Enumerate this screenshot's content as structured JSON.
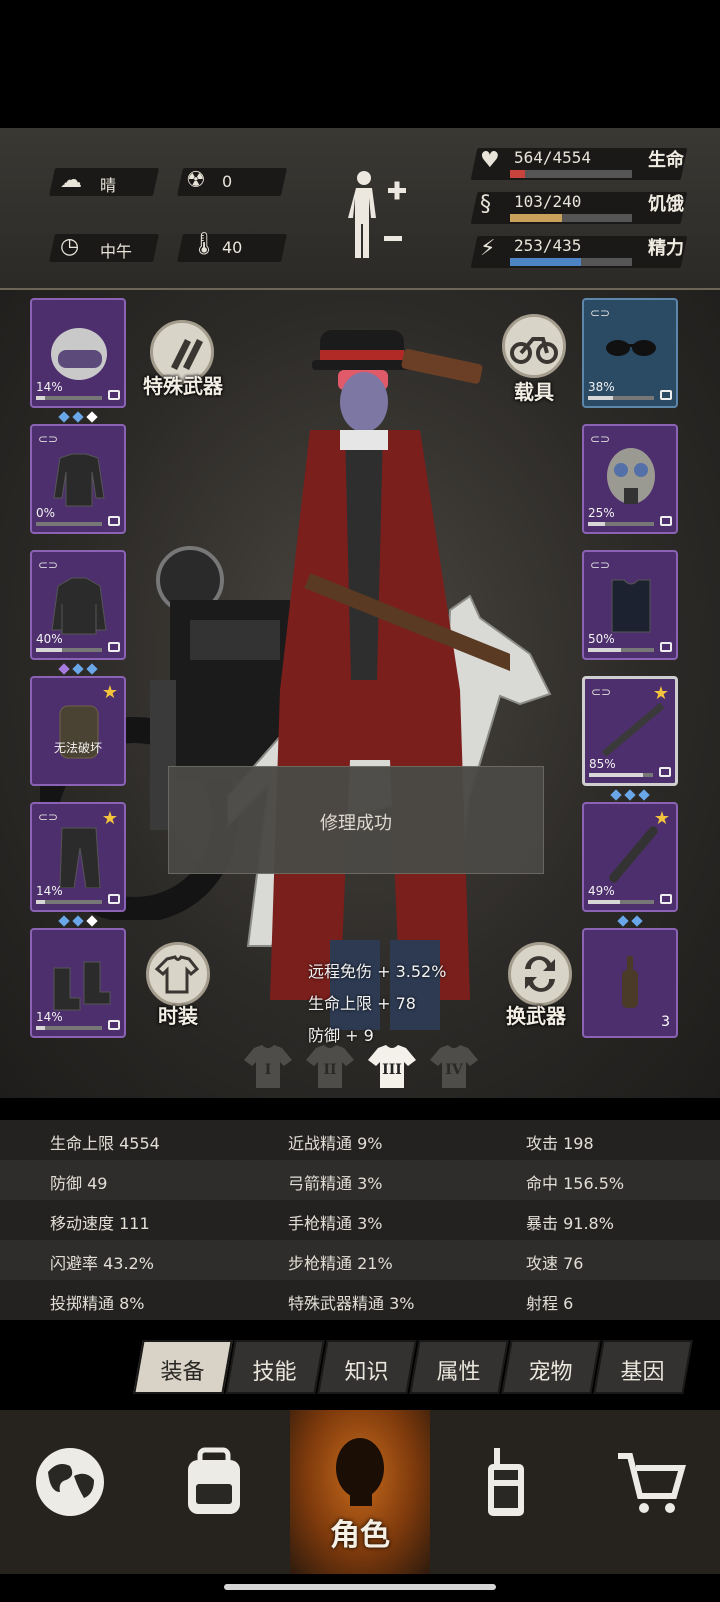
{
  "status": {
    "weather": {
      "icon": "cloud-sun-icon",
      "label": "晴"
    },
    "radiation": {
      "icon": "radiation-icon",
      "value": "0"
    },
    "time": {
      "icon": "clock-icon",
      "label": "中午"
    },
    "temperature": {
      "icon": "thermometer-icon",
      "value": "40"
    },
    "vitals": [
      {
        "icon": "heart-pulse-icon",
        "value": "564/4554",
        "name": "生命",
        "fraction": 0.124,
        "color": "#c8433b"
      },
      {
        "icon": "stomach-icon",
        "value": "103/240",
        "name": "饥饿",
        "fraction": 0.429,
        "color": "#c9a15b"
      },
      {
        "icon": "energy-head-icon",
        "value": "253/435",
        "name": "精力",
        "fraction": 0.582,
        "color": "#4d84c4"
      }
    ]
  },
  "left_slots": [
    {
      "name": "police-helmet",
      "pct": "14%",
      "durability": 0.14,
      "linked": false,
      "star": false,
      "gems": [
        "#6aa7e8",
        "#6aa7e8",
        "#ffffff"
      ]
    },
    {
      "name": "black-shirt",
      "pct": "0%",
      "durability": 0.0,
      "linked": true,
      "star": false,
      "gems": []
    },
    {
      "name": "hooded-jacket",
      "pct": "40%",
      "durability": 0.4,
      "linked": true,
      "star": false,
      "gems": [
        "#a77be0",
        "#6aa7e8",
        "#6aa7e8"
      ]
    },
    {
      "name": "backpack",
      "pct": "",
      "durability": 1.0,
      "linked": false,
      "star": true,
      "unbreakable": "无法破坏",
      "gems": []
    },
    {
      "name": "cargo-pants",
      "pct": "14%",
      "durability": 0.14,
      "linked": true,
      "star": true,
      "gems": [
        "#6aa7e8",
        "#6aa7e8",
        "#ffffff"
      ]
    },
    {
      "name": "boots",
      "pct": "14%",
      "durability": 0.14,
      "linked": false,
      "star": false,
      "gems": []
    }
  ],
  "right_slots": [
    {
      "name": "sunglasses",
      "pct": "38%",
      "durability": 0.38,
      "linked": true,
      "star": false,
      "gems": []
    },
    {
      "name": "gas-mask",
      "pct": "25%",
      "durability": 0.25,
      "linked": true,
      "star": false,
      "gems": []
    },
    {
      "name": "police-vest",
      "pct": "50%",
      "durability": 0.5,
      "linked": true,
      "star": false,
      "gems": []
    },
    {
      "name": "rifle",
      "pct": "85%",
      "durability": 0.85,
      "linked": true,
      "star": true,
      "gems": [
        "#6aa7e8",
        "#6aa7e8",
        "#6aa7e8"
      ]
    },
    {
      "name": "spiked-bat",
      "pct": "49%",
      "durability": 0.49,
      "linked": false,
      "star": true,
      "gems": [
        "#6aa7e8",
        "#6aa7e8"
      ]
    },
    {
      "name": "molotov",
      "pct": "",
      "durability": 1.0,
      "linked": false,
      "star": false,
      "count": "3",
      "gems": []
    }
  ],
  "buttons": {
    "special_weapon": "特殊武器",
    "vehicle": "载具",
    "fashion": "时装",
    "swap_weapon": "换武器"
  },
  "toast": "修理成功",
  "bonuses": [
    "远程免伤 + 3.52%",
    "生命上限 + 78",
    "防御 + 9"
  ],
  "outfit_tabs": [
    "I",
    "II",
    "III",
    "IV"
  ],
  "active_outfit": 2,
  "attributes": [
    [
      "生命上限 4554",
      "近战精通 9%",
      "攻击 198"
    ],
    [
      "防御 49",
      "弓箭精通 3%",
      "命中 156.5%"
    ],
    [
      "移动速度 111",
      "手枪精通 3%",
      "暴击 91.8%"
    ],
    [
      "闪避率 43.2%",
      "步枪精通 21%",
      "攻速 76"
    ],
    [
      "投掷精通 8%",
      "特殊武器精通 3%",
      "射程 6"
    ]
  ],
  "tabs": [
    "装备",
    "技能",
    "知识",
    "属性",
    "宠物",
    "基因"
  ],
  "active_tab": 0,
  "nav": [
    {
      "icon": "globe-icon",
      "label": ""
    },
    {
      "icon": "backpack-icon",
      "label": ""
    },
    {
      "icon": "character-head-icon",
      "label": "角色"
    },
    {
      "icon": "walkie-talkie-icon",
      "label": ""
    },
    {
      "icon": "shopping-cart-icon",
      "label": ""
    }
  ]
}
